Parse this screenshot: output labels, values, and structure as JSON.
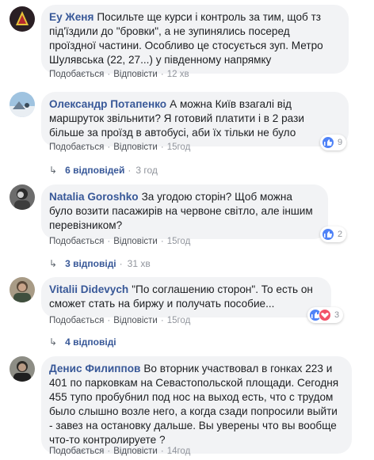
{
  "comments": [
    {
      "author": "Еу Женя",
      "text": "Посильте ще курси і контроль за тим, щоб тз під'їздили до \"бровки\", а не зупинялись посеред проїздної частини. Особливо це стосується зуп. Метро Шулявська (22, 27...) у південному напрямку",
      "like": "Подобається",
      "reply": "Відповісти",
      "time": "12 хв"
    },
    {
      "author": "Олександр Потапенко",
      "text": "А можна Київ взагалі від маршруток звільнити? Я готовий платити і в 2 рази більше за проїзд в автобусі, аби їх тільки не було",
      "like": "Подобається",
      "reply": "Відповісти",
      "time": "15год",
      "reaction_count": "9",
      "replies_label": "6 відповідей",
      "replies_time": "3 год"
    },
    {
      "author": "Natalia Goroshko",
      "text": "За угодою сторін? Щоб можна було возити пасажирів на червоне світло, але іншим перевізником?",
      "like": "Подобається",
      "reply": "Відповісти",
      "time": "15год",
      "reaction_count": "2",
      "replies_label": "3 відповіді",
      "replies_time": "31 хв"
    },
    {
      "author": "Vitalii Didevych",
      "text": "\"По соглашению сторон\". То есть он сможет стать на биржу и получать пособие...",
      "like": "Подобається",
      "reply": "Відповісти",
      "time": "15год",
      "reaction_count": "3",
      "replies_label": "4 відповіді"
    },
    {
      "author": "Денис Филиппов",
      "text": "Во вторник участвовал в гонках 223 и 401 по парковкам на Севастопольской площади. Сегодня 455 тупо пробубнил под нос на выход есть, что с трудом было слышно возле него, а когда сзади попросили выйти - завез на остановку дальше. Вы уверены что вы вообще что-то контролируете ?",
      "like": "Подобається",
      "reply": "Відповісти",
      "time": "14год"
    }
  ],
  "separator": "·",
  "reply_arrow": "↳",
  "colors": {
    "author": "#385898",
    "bubble": "#f2f3f5",
    "like_icon": "#4f82f7",
    "love_icon": "#f25268"
  }
}
